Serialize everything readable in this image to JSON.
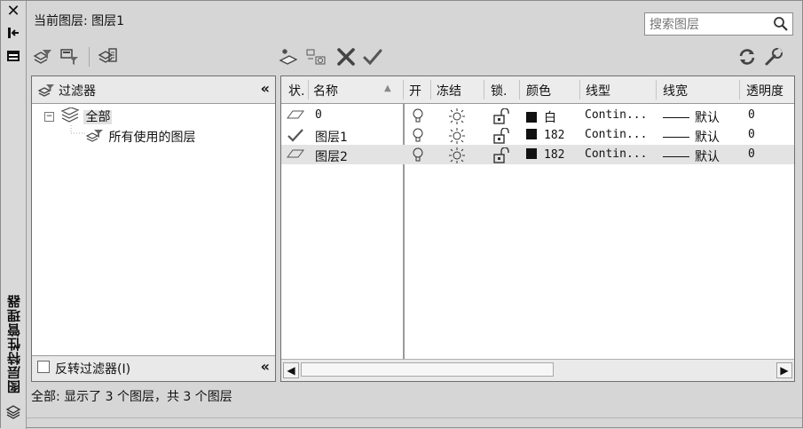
{
  "window": {
    "vertical_title": "图层特性管理器"
  },
  "header": {
    "current_layer": "当前图层: 图层1"
  },
  "search": {
    "placeholder": "搜索图层",
    "value": ""
  },
  "filters": {
    "title": "过滤器",
    "collapse_glyph": "«",
    "tree": [
      {
        "label": "全部",
        "expander": "−"
      },
      {
        "label": "所有使用的图层"
      }
    ],
    "invert_label": "反转过滤器(I)",
    "invert_checked": false
  },
  "grid": {
    "columns": [
      "状.",
      "名称",
      "开",
      "冻结",
      "锁.",
      "颜色",
      "线型",
      "线宽",
      "透明度"
    ],
    "rows": [
      {
        "status_icon": "layer-icon",
        "name": "0",
        "on": "lightbulb-on",
        "freeze": "sun-icon",
        "lock": "unlock-icon",
        "color_label": "白",
        "color_hex": "#111111",
        "linetype": "Contin...",
        "lineweight": "默认",
        "transparency": "0"
      },
      {
        "status_icon": "checkmark-icon",
        "name": "图层1",
        "on": "lightbulb-on",
        "freeze": "sun-icon",
        "lock": "unlock-icon",
        "color_label": "182",
        "color_hex": "#111111",
        "linetype": "Contin...",
        "lineweight": "默认",
        "transparency": "0"
      },
      {
        "status_icon": "layer-icon",
        "name": "图层2",
        "on": "lightbulb-on",
        "freeze": "sun-icon",
        "lock": "unlock-icon",
        "color_label": "182",
        "color_hex": "#111111",
        "linetype": "Contin...",
        "lineweight": "默认",
        "transparency": "0"
      }
    ]
  },
  "status": {
    "text": "全部: 显示了 3 个图层，共 3 个图层"
  },
  "icons": {
    "left_toolbar": [
      "new-property-filter-icon",
      "new-group-filter-icon",
      "layer-states-manager-icon"
    ],
    "layer_toolbar": [
      "new-layer-icon",
      "new-layer-vp-frozen-icon",
      "delete-layer-icon",
      "set-current-icon"
    ],
    "right_toolbar": [
      "refresh-icon",
      "settings-wrench-icon"
    ]
  }
}
